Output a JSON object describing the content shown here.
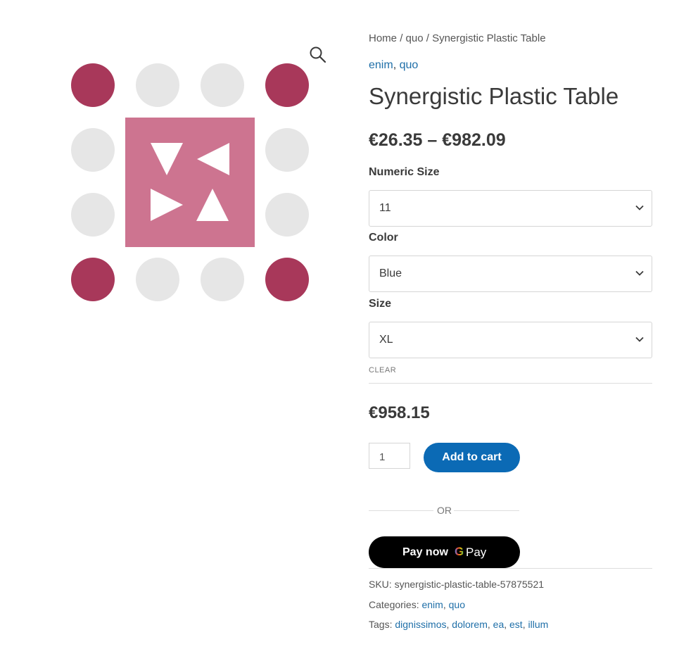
{
  "colors": {
    "dark": "#a8385a",
    "light": "#e6e6e6",
    "pink": "#cd7490",
    "link": "#1f6fa8",
    "button": "#0b6ab5"
  },
  "gallery": {
    "zoom_icon": "magnifier-icon"
  },
  "breadcrumb": {
    "items": [
      "Home",
      "quo",
      "Synergistic Plastic Table"
    ],
    "separator": "/"
  },
  "categories_top": [
    "enim",
    "quo"
  ],
  "product": {
    "title": "Synergistic Plastic Table",
    "price_range": "€26.35 – €982.09",
    "variation_price": "€958.15"
  },
  "variations": [
    {
      "label": "Numeric Size",
      "value": "11"
    },
    {
      "label": "Color",
      "value": "Blue"
    },
    {
      "label": "Size",
      "value": "XL"
    }
  ],
  "clear_label": "CLEAR",
  "cart": {
    "quantity": "1",
    "add_label": "Add to cart"
  },
  "or_label": "OR",
  "gpay": {
    "label": "Pay now",
    "g": "G",
    "pay": "Pay"
  },
  "meta": {
    "sku_label": "SKU:",
    "sku": "synergistic-plastic-table-57875521",
    "categories_label": "Categories:",
    "categories": [
      "enim",
      "quo"
    ],
    "tags_label": "Tags:",
    "tags": [
      "dignissimos",
      "dolorem",
      "ea",
      "est",
      "illum"
    ]
  }
}
